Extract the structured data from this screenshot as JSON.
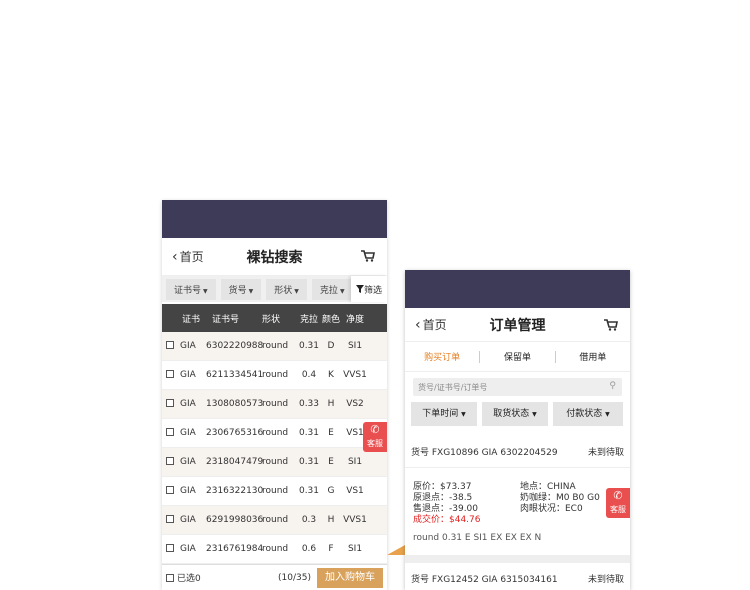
{
  "search_screen": {
    "back_label": "首页",
    "title": "裸钻搜索",
    "filters": [
      "证书号",
      "货号",
      "形状",
      "克拉"
    ],
    "screen_label": "筛选",
    "columns": [
      "证书",
      "证书号",
      "形状",
      "克拉",
      "颜色",
      "净度"
    ],
    "rows": [
      {
        "lab": "GIA",
        "cert": "6302220988",
        "shape": "round",
        "carat": "0.31",
        "color": "D",
        "clarity": "SI1"
      },
      {
        "lab": "GIA",
        "cert": "6211334541",
        "shape": "round",
        "carat": "0.4",
        "color": "K",
        "clarity": "VVS1"
      },
      {
        "lab": "GIA",
        "cert": "1308080573",
        "shape": "round",
        "carat": "0.33",
        "color": "H",
        "clarity": "VS2"
      },
      {
        "lab": "GIA",
        "cert": "2306765316",
        "shape": "round",
        "carat": "0.31",
        "color": "E",
        "clarity": "VS1"
      },
      {
        "lab": "GIA",
        "cert": "2318047479",
        "shape": "round",
        "carat": "0.31",
        "color": "E",
        "clarity": "SI1"
      },
      {
        "lab": "GIA",
        "cert": "2316322130",
        "shape": "round",
        "carat": "0.31",
        "color": "G",
        "clarity": "VS1"
      },
      {
        "lab": "GIA",
        "cert": "6291998036",
        "shape": "round",
        "carat": "0.3",
        "color": "H",
        "clarity": "VVS1"
      },
      {
        "lab": "GIA",
        "cert": "2316761984",
        "shape": "round",
        "carat": "0.6",
        "color": "F",
        "clarity": "SI1"
      }
    ],
    "selected_label": "已选0",
    "count": "(10/35)",
    "add_cart": "加入购物车",
    "service_label": "客服"
  },
  "order_screen": {
    "back_label": "首页",
    "title": "订单管理",
    "tabs": [
      "购买订单",
      "保留单",
      "借用单"
    ],
    "search_placeholder": "货号/证书号/订单号",
    "dropdowns": [
      "下单时间",
      "取货状态",
      "付款状态"
    ],
    "order1": {
      "header": "货号 FXG10896 GIA 6302204529",
      "status": "未到待取",
      "original_price": "原价：$73.37",
      "original_rebate": "原退点：-38.5",
      "sale_rebate": "售退点：-39.00",
      "final_price": "成交价：$44.76",
      "location": "地点：CHINA",
      "milky": "奶咖绿：M0 B0 G0",
      "eye_clean": "肉眼状况：EC0",
      "description": "round 0.31 E SI1 EX EX EX N"
    },
    "order2": {
      "header": "货号 FXG12452 GIA 6315034161",
      "status": "未到待取"
    },
    "service_label": "客服"
  },
  "colors": {
    "statusbar": "#3d3b57",
    "accent": "#e67e22",
    "service": "#e94f4f",
    "cart_button": "#d9a25c"
  }
}
